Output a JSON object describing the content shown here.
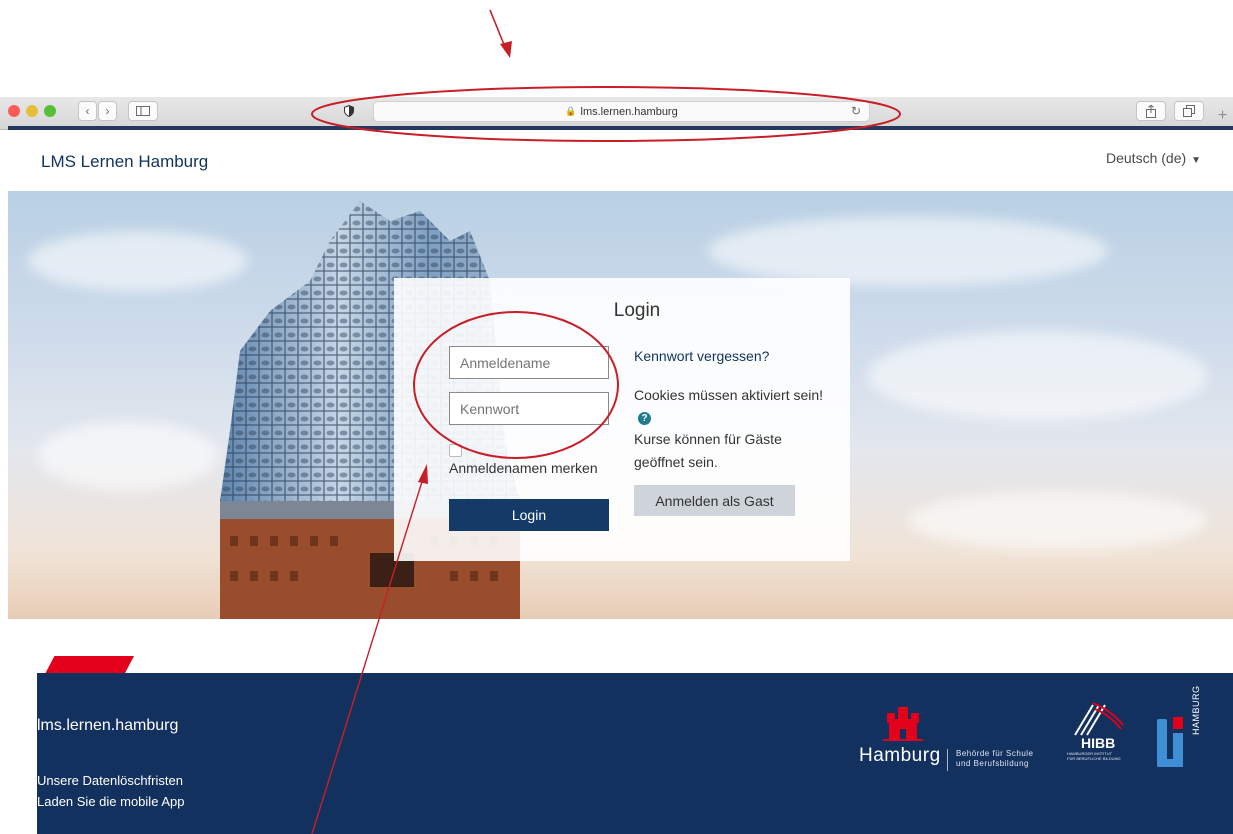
{
  "browser": {
    "url": "lms.lernen.hamburg",
    "url_lock_icon": "lock-icon",
    "reload_icon": "reload-icon"
  },
  "header": {
    "site_title": "LMS Lernen Hamburg",
    "language": "Deutsch (de)"
  },
  "login": {
    "title": "Login",
    "username_placeholder": "Anmeldename",
    "password_placeholder": "Kennwort",
    "remember_label": "Anmeldenamen merken",
    "login_button": "Login",
    "forgot_link": "Kennwort vergessen?",
    "cookies_text": "Cookies müssen aktiviert sein!",
    "guests_text": "Kurse können für Gäste geöffnet sein.",
    "guest_button": "Anmelden als Gast"
  },
  "footer": {
    "site": "lms.lernen.hamburg",
    "links": [
      "Unsere Datenlöschfristen",
      "Laden Sie die mobile App"
    ],
    "hamburg_name": "Hamburg",
    "hamburg_sub_1": "Behörde für Schule",
    "hamburg_sub_2": "und Berufsbildung",
    "hibb_name": "HIBB",
    "hibb_sub_1": "HAMBURGER INSTITUT",
    "hibb_sub_2": "FÜR BERUFLICHE BILDUNG",
    "li_name": "HAMBURG"
  },
  "colors": {
    "brand_navy": "#13315e",
    "accent_red": "#e2001a",
    "annotation_red": "#c81e28"
  }
}
